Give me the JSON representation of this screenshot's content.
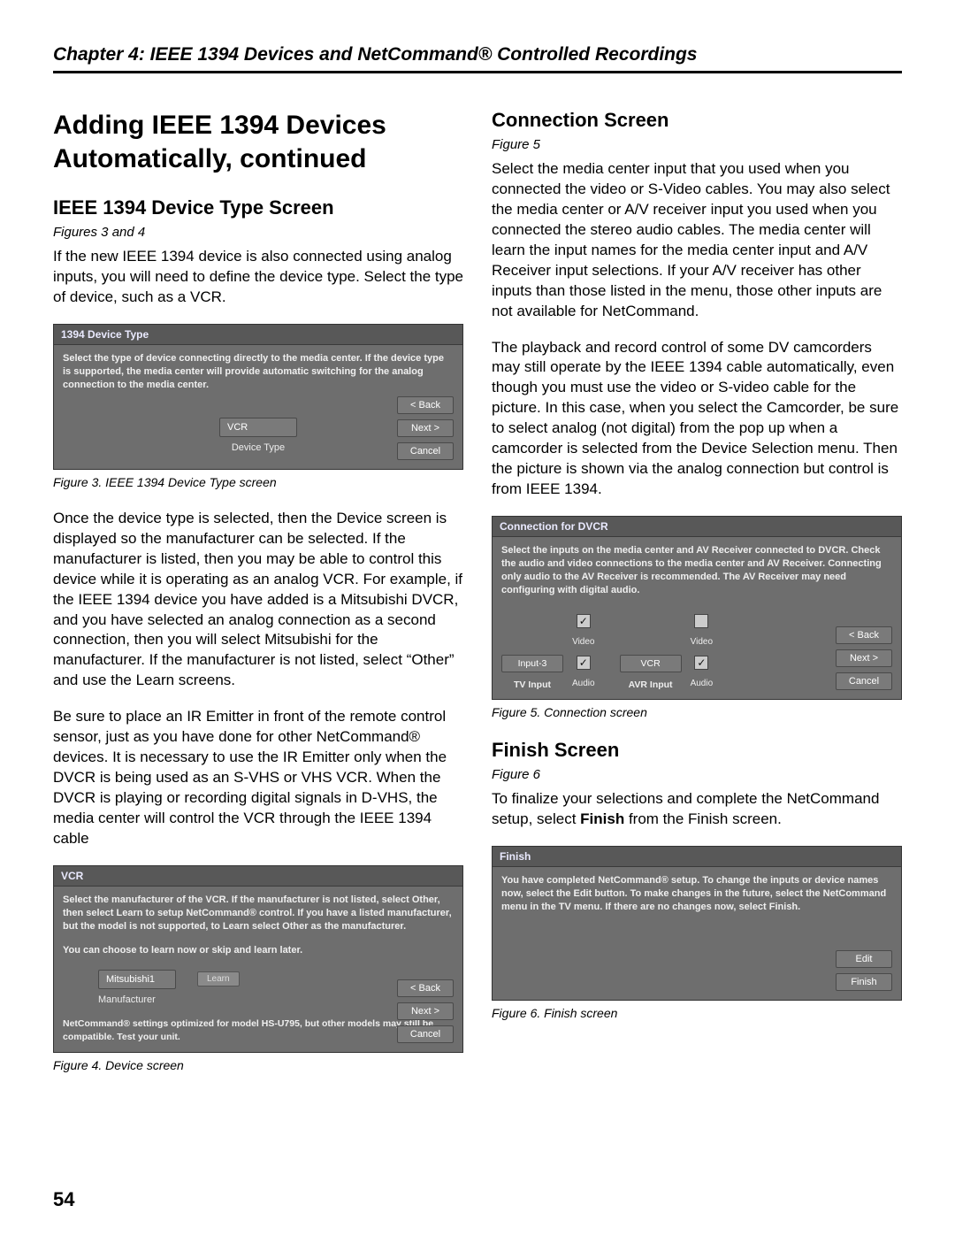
{
  "chapter": "Chapter 4:  IEEE 1394 Devices and NetCommand® Controlled Recordings",
  "page_number": "54",
  "left": {
    "title": "Adding IEEE 1394 Devices Automatically, continued",
    "s1_title": "IEEE 1394 Device Type Screen",
    "s1_figref": "Figures 3 and 4",
    "s1_p1": "If the new IEEE 1394 device is also connected using analog inputs, you will need to define the device type.  Select the type of device, such as a VCR.",
    "fig3_caption": "Figure 3. IEEE 1394 Device Type screen",
    "s1_p2": "Once the device type is selected, then the Device screen is displayed so the manufacturer can be selected.  If the manufacturer is listed, then you may be able to control this device while it is operating as an analog VCR.  For example, if the IEEE 1394 device you have added is a Mitsubishi DVCR, and you have selected an analog connection as a second connection, then you will select Mitsubishi for the manufacturer.  If the manufacturer is not listed, select “Other” and use the Learn screens.",
    "s1_p3": "Be sure to place an IR Emitter in front of the remote control sensor, just as you have done for other NetCommand® devices.  It is necessary to use the IR Emitter only when the DVCR is being used as an S-VHS or VHS VCR.  When the DVCR is playing or recording digital signals in D-VHS, the media center will control the VCR through the IEEE 1394 cable",
    "fig4_caption": "Figure 4.  Device  screen"
  },
  "right": {
    "s2_title": "Connection Screen",
    "s2_figref": "Figure 5",
    "s2_p1": "Select the media center input that you used when you connected the video or S-Video cables.  You may also select the media center or A/V receiver input you used when you connected the stereo audio cables.  The media center will learn the input names for the media center input and A/V Receiver input selections.  If your A/V receiver has other inputs than those listed in the menu, those other inputs are not available for NetCommand.",
    "s2_p2": "The playback and record control of some DV camcorders may still operate by the IEEE 1394 cable automatically, even though you must use the video or S-video cable for the picture.  In this case, when you select the Camcorder, be sure to select analog (not digital) from the pop up when a camcorder is selected from the Device Selection menu.  Then the picture is shown via the analog connection but control is from IEEE 1394.",
    "fig5_caption": "Figure 5. Connection screen",
    "s3_title": "Finish Screen",
    "s3_figref": "Figure 6",
    "s3_p1_a": "To finalize your selections and complete the NetCommand setup, select ",
    "s3_p1_bold": "Finish",
    "s3_p1_b": " from the Finish screen.",
    "fig6_caption": "Figure 6. Finish screen"
  },
  "dlg1": {
    "title": "1394 Device Type",
    "instruction": "Select the type of device connecting directly to the media center.  If the device type is supported, the media center will provide automatic switching for the analog connection to the media center.",
    "field_value": "VCR",
    "field_label": "Device Type",
    "back": "< Back",
    "next": "Next >",
    "cancel": "Cancel"
  },
  "dlg2": {
    "title": "VCR",
    "instruction": "Select the manufacturer of the VCR.   If the manufacturer is not listed, select Other, then select Learn to setup NetCommand® control. If you have a listed manufacturer, but the model is not supported, to Learn select Other as the  manufacturer.",
    "hint": "You can choose to learn now or skip and learn later.",
    "field_value": "Mitsubishi1",
    "learn": "Learn",
    "field_label": "Manufacturer",
    "note": "NetCommand® settings optimized for model HS-U795, but other models may still be compatible. Test your unit.",
    "back": "< Back",
    "next": "Next >",
    "cancel": "Cancel"
  },
  "dlg3": {
    "title": "Connection for DVCR",
    "instruction": "Select the inputs on the media center and AV Receiver connected to DVCR.  Check the audio and video connections to the media center and AV Receiver.  Connecting only audio to the AV Receiver is recommended.  The AV Receiver may need configuring with digital audio.",
    "g1_top": "Input-3",
    "g1_sub": "TV Input",
    "g2_top": "VCR",
    "g2_sub": "AVR Input",
    "video": "Video",
    "audio": "Audio",
    "back": "< Back",
    "next": "Next >",
    "cancel": "Cancel"
  },
  "dlg4": {
    "title": "Finish",
    "instruction": "You have completed NetCommand® setup.  To change the inputs or device names now, select the Edit button.  To make changes in the future, select the NetCommand menu in the TV menu.  If there are no changes now, select Finish.",
    "edit": "Edit",
    "finish": "Finish"
  }
}
